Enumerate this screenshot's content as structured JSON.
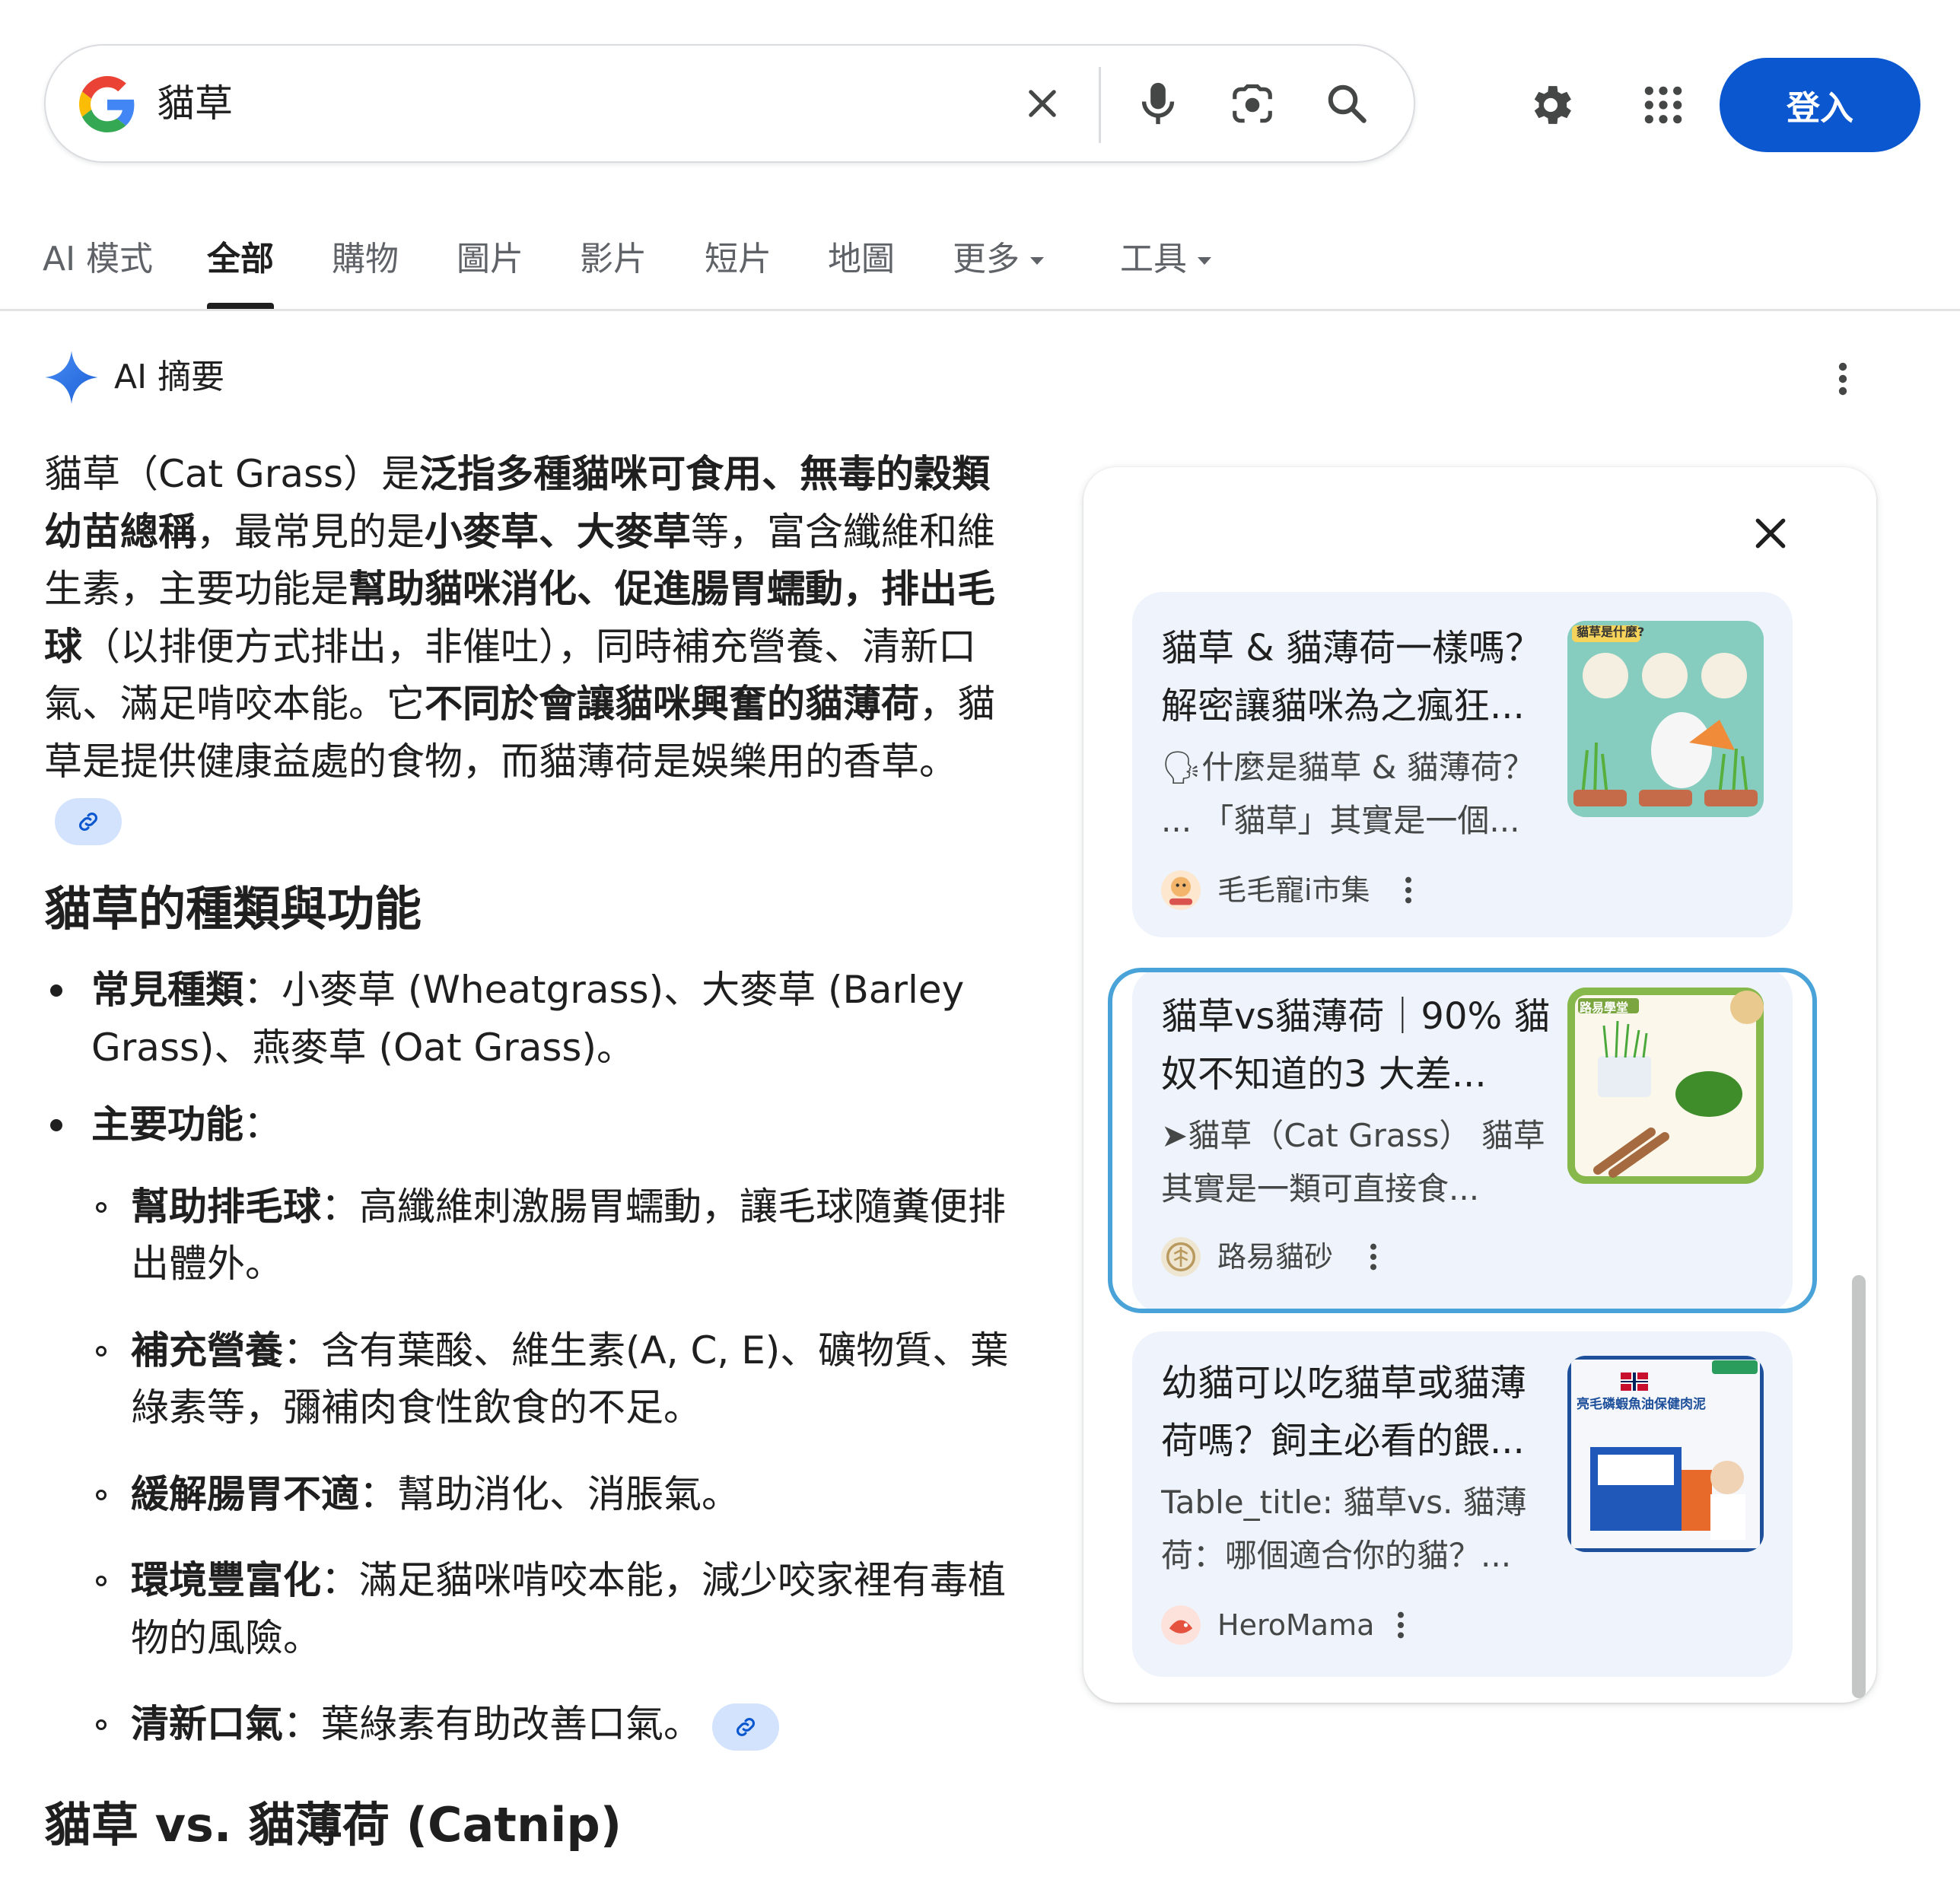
{
  "search": {
    "query": "貓草"
  },
  "header": {
    "signin_label": "登入"
  },
  "tabs": [
    "AI 模式",
    "全部",
    "購物",
    "圖片",
    "影片",
    "短片",
    "地圖",
    "更多",
    "工具"
  ],
  "ai_overview": {
    "title": "AI 摘要",
    "intro": {
      "t1": "貓草（Cat Grass）是",
      "b1": "泛指多種貓咪可食用、無毒的穀類幼苗總稱",
      "t2": "，最常見的是",
      "b2": "小麥草、大麥草",
      "t3": "等，富含纖維和維生素，主要功能是",
      "b3": "幫助貓咪消化、促進腸胃蠕動，排出毛球",
      "t4": "（以排便方式排出，非催吐），同時補充營養、清新口氣、滿足啃咬本能。它",
      "b4": "不同於會讓貓咪興奮的貓薄荷",
      "t5": "，貓草是提供健康益處的食物，而貓薄荷是娛樂用的香草。"
    },
    "section1": {
      "heading": "貓草的種類與功能",
      "common_label": "常見種類",
      "common_text": "：小麥草 (Wheatgrass)、大麥草 (Barley Grass)、燕麥草 (Oat Grass)。",
      "main_label": "主要功能",
      "main_colon": "：",
      "functions": [
        {
          "label": "幫助排毛球",
          "text": "：高纖維刺激腸胃蠕動，讓毛球隨糞便排出體外。"
        },
        {
          "label": "補充營養",
          "text": "：含有葉酸、維生素(A, C, E)、礦物質、葉綠素等，彌補肉食性飲食的不足。"
        },
        {
          "label": "緩解腸胃不適",
          "text": "：幫助消化、消脹氣。"
        },
        {
          "label": "環境豐富化",
          "text": "：滿足貓咪啃咬本能，減少咬家裡有毒植物的風險。"
        },
        {
          "label": "清新口氣",
          "text": "：葉綠素有助改善口氣。"
        }
      ]
    },
    "section2": {
      "heading": "貓草 vs. 貓薄荷 (Catnip)"
    }
  },
  "sources": [
    {
      "title": "貓草 & 貓薄荷一樣嗎？解密讓貓咪為之瘋狂...",
      "snippet": "🗣什麼是貓草 & 貓薄荷？ ... 「貓草」其實是一個...",
      "site": "毛毛寵i市集",
      "thumb_text": "貓草是什麼?"
    },
    {
      "title": "貓草vs貓薄荷｜90% 貓奴不知道的3 大差...",
      "snippet": "➤貓草（Cat Grass） 貓草其實是一類可直接食...",
      "site": "路易貓砂",
      "thumb_text": "路易學堂"
    },
    {
      "title": "幼貓可以吃貓草或貓薄荷嗎？飼主必看的餵...",
      "snippet": "Table_title: 貓草vs. 貓薄荷：哪個適合你的貓？...",
      "site": "HeroMama",
      "thumb_text": "亮毛磷蝦魚油保健肉泥"
    }
  ],
  "colors": {
    "accent": "#0b57d0",
    "card_bg": "#eef3fc",
    "focus": "#4aa3d8"
  }
}
